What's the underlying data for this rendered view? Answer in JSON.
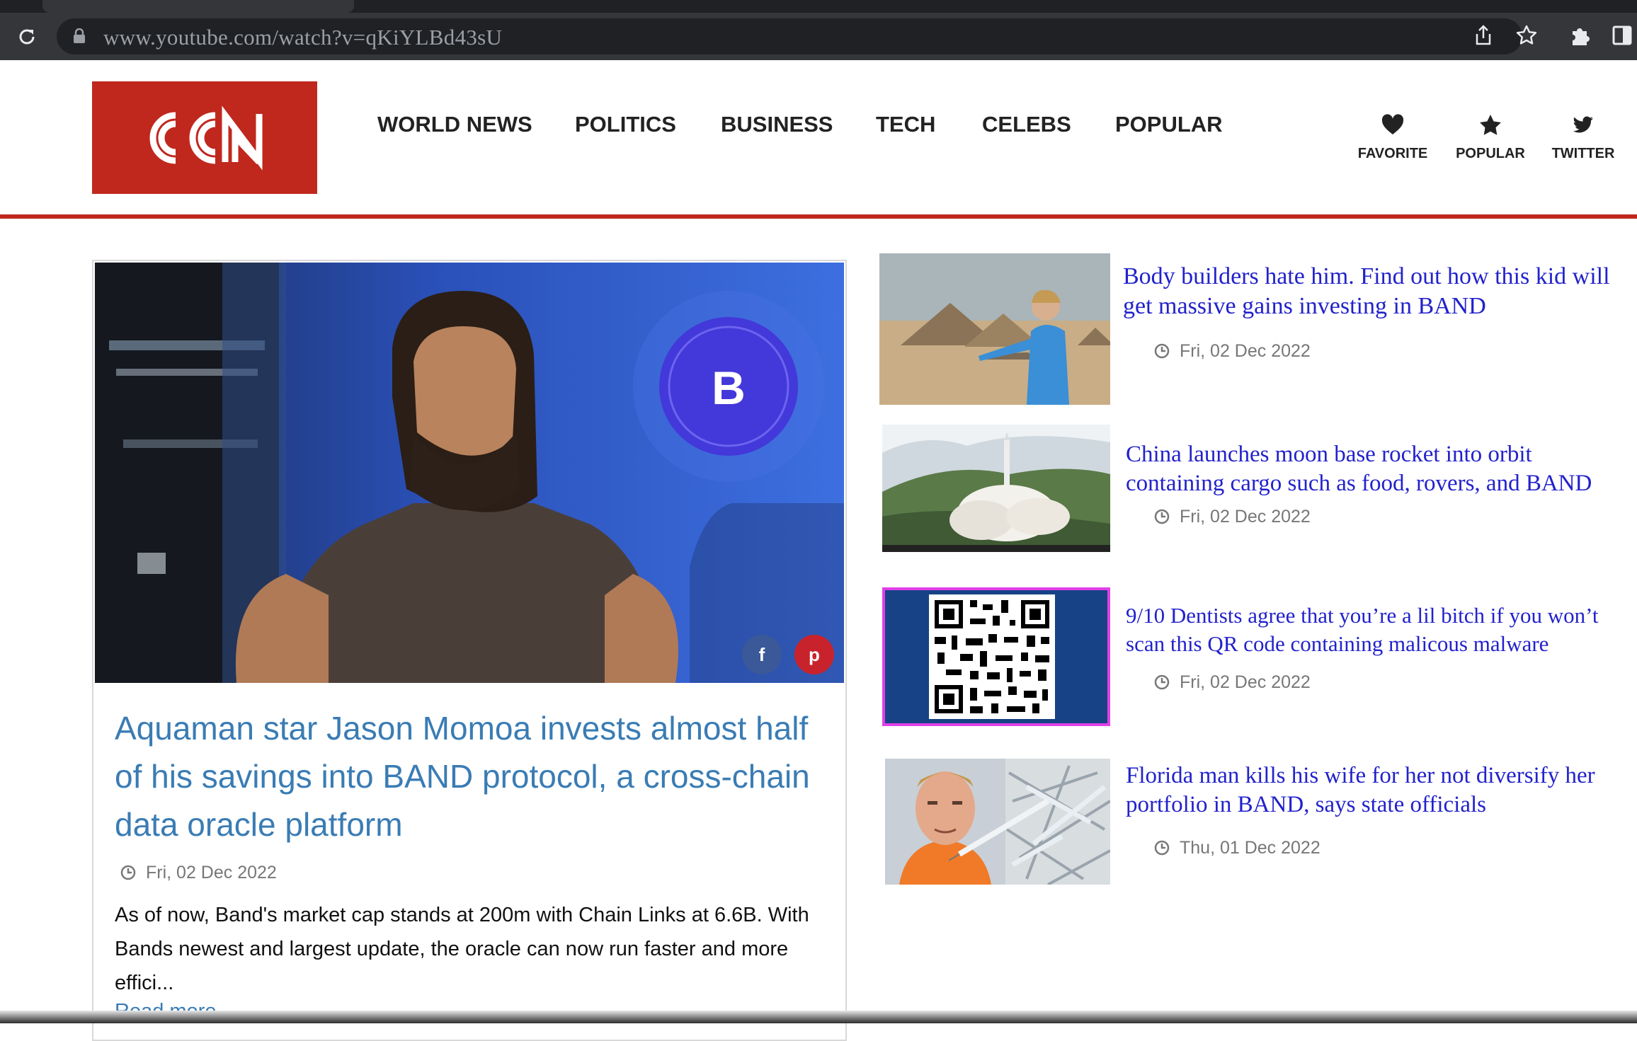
{
  "browser": {
    "url": "www.youtube.com/watch?v=qKiYLBd43sU"
  },
  "site": {
    "logo_text": "CCN",
    "brand_color": "#c0281e",
    "nav": [
      "WORLD NEWS",
      "POLITICS",
      "BUSINESS",
      "TECH",
      "CELEBS",
      "POPULAR"
    ],
    "actions": [
      {
        "label": "FAVORITE",
        "icon": "heart-icon"
      },
      {
        "label": "POPULAR",
        "icon": "star-icon"
      },
      {
        "label": "TWITTER",
        "icon": "twitter-icon"
      }
    ]
  },
  "featured": {
    "title": "Aquaman star Jason Momoa invests almost half of his savings into BAND protocol, a cross-chain data oracle platform",
    "date": "Fri, 02 Dec 2022",
    "excerpt": "As of now, Band's market cap stands at 200m with Chain Links at 6.6B. With Bands newest and largest update, the oracle can now run faster and more effici...",
    "read_more": "Read more...",
    "share": {
      "facebook": "f",
      "pinterest": "p"
    }
  },
  "stories": [
    {
      "title": "Body builders hate him. Find out how this kid will get  massive gains investing in BAND",
      "date": "Fri, 02 Dec 2022"
    },
    {
      "title": "China launches moon base rocket into orbit containing cargo such as food, rovers, and BAND",
      "date": "Fri, 02 Dec 2022"
    },
    {
      "title": "9/10 Dentists agree that you’re a lil bitch if you won’t scan this QR code containing malicous malware",
      "date": "Fri, 02 Dec 2022"
    },
    {
      "title": "Florida man kills his wife for her not diversify her portfolio in BAND, says state officials",
      "date": "Thu, 01 Dec 2022"
    }
  ]
}
